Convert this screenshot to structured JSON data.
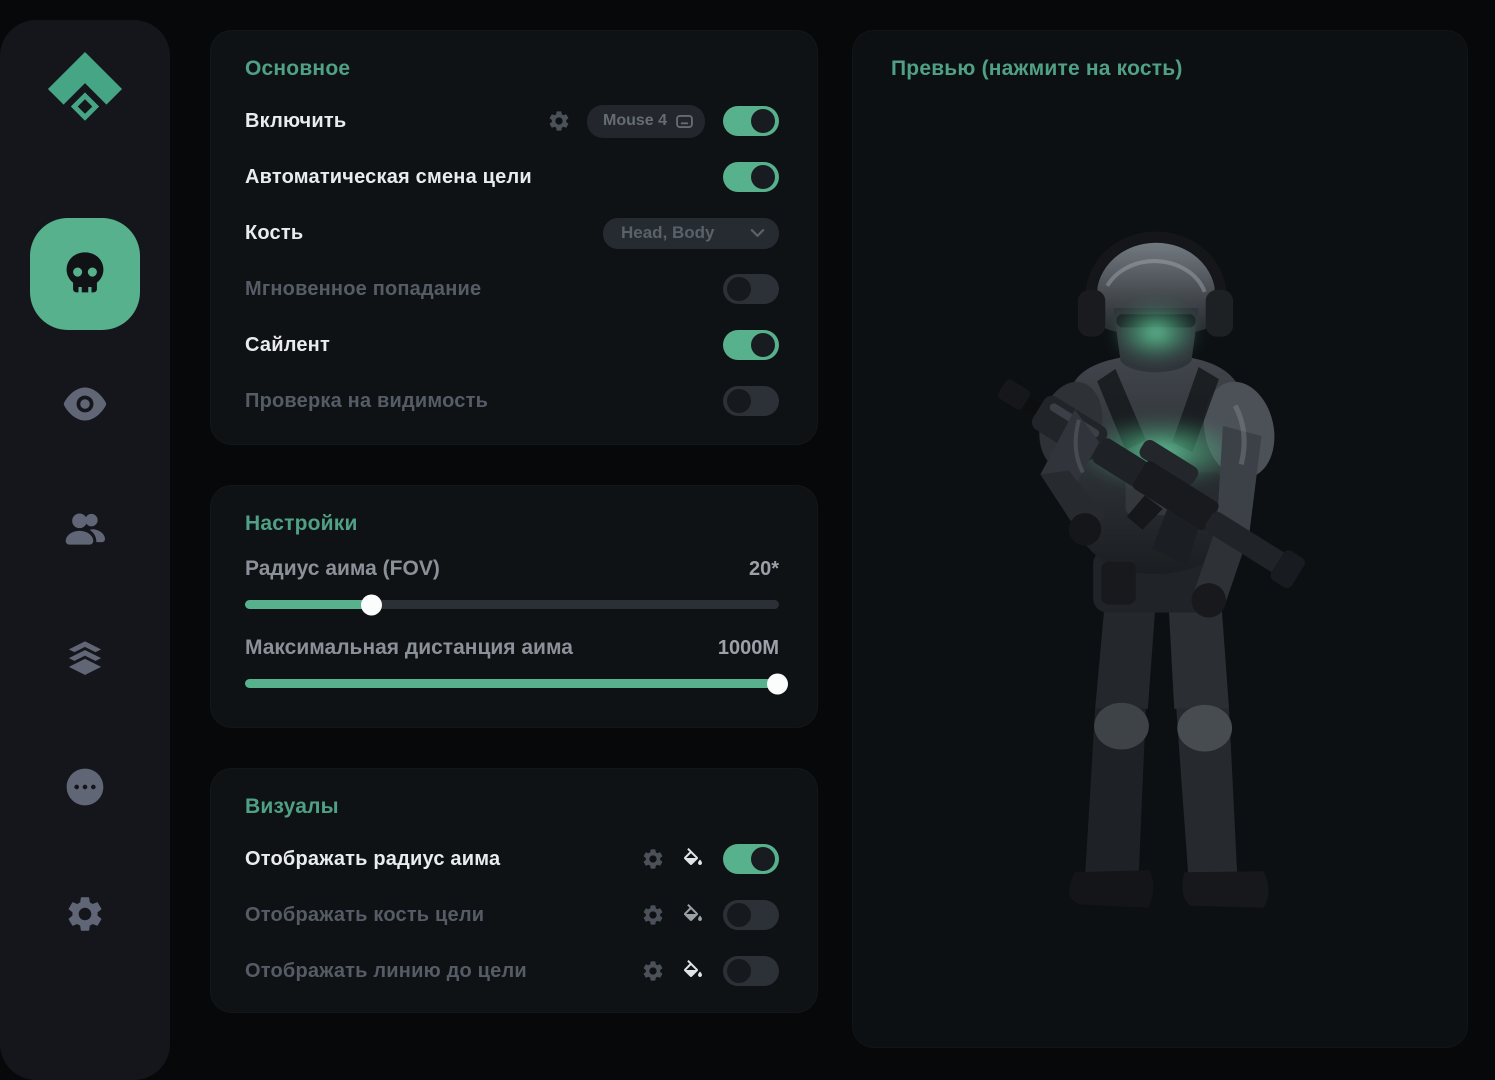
{
  "colors": {
    "accent_green": "#57b18d",
    "title_green": "#4fa085",
    "panel_bg": "#0f1215",
    "sidebar_bg": "#15161b"
  },
  "sidebar": {
    "logo_icon": "brand-diamond-logo",
    "items": [
      {
        "icon": "skull-icon",
        "active": true
      },
      {
        "icon": "eye-icon",
        "active": false
      },
      {
        "icon": "users-icon",
        "active": false
      },
      {
        "icon": "layers-icon",
        "active": false
      },
      {
        "icon": "chat-dots-icon",
        "active": false
      },
      {
        "icon": "gear-icon",
        "active": false
      }
    ]
  },
  "main": {
    "title": "Основное",
    "rows": [
      {
        "label": "Включить",
        "type": "toggle",
        "on": true,
        "muted": false,
        "has_gear": true,
        "keybind": "Mouse 4"
      },
      {
        "label": "Автоматическая смена цели",
        "type": "toggle",
        "on": true,
        "muted": false
      },
      {
        "label": "Кость",
        "type": "dropdown",
        "value": "Head, Body"
      },
      {
        "label": "Мгновенное попадание",
        "type": "toggle",
        "on": false,
        "muted": true
      },
      {
        "label": "Сайлент",
        "type": "toggle",
        "on": true,
        "muted": false
      },
      {
        "label": "Проверка на видимость",
        "type": "toggle",
        "on": false,
        "muted": true
      }
    ]
  },
  "settings": {
    "title": "Настройки",
    "sliders": [
      {
        "label": "Радиус аима (FOV)",
        "value": "20*",
        "percent": 24
      },
      {
        "label": "Максимальная дистанция аима",
        "value": "1000M",
        "percent": 100
      }
    ]
  },
  "visuals": {
    "title": "Визуалы",
    "rows": [
      {
        "label": "Отображать радиус аима",
        "on": true,
        "muted": false
      },
      {
        "label": "Отображать кость цели",
        "on": false,
        "muted": true
      },
      {
        "label": "Отображать линию до цели",
        "on": false,
        "muted": true
      }
    ]
  },
  "preview": {
    "title": "Превью (нажмите на кость)",
    "highlighted_bones": [
      "Head",
      "Body"
    ]
  }
}
